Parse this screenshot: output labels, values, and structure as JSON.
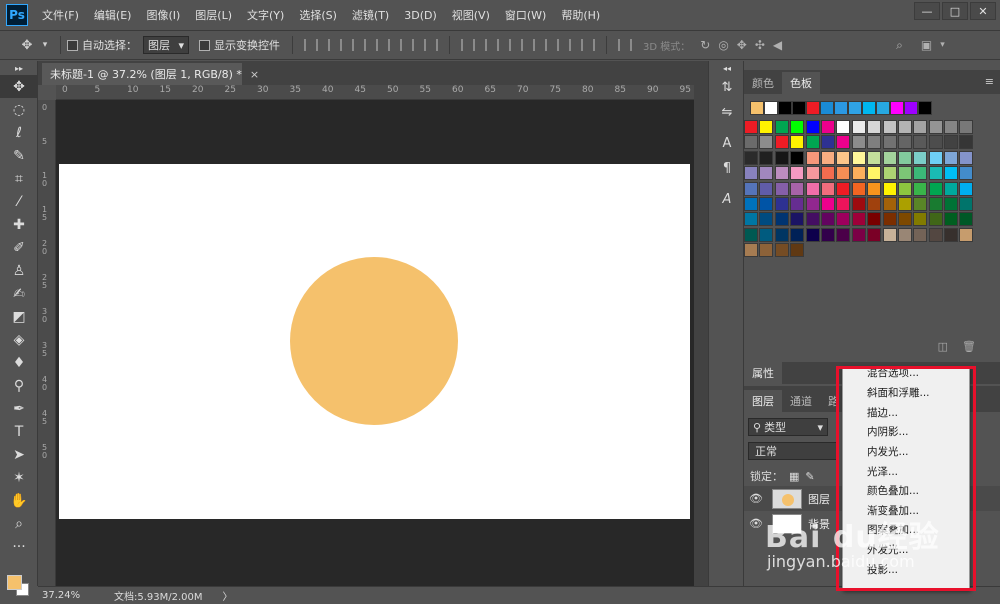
{
  "app": {
    "logo": "Ps"
  },
  "menu": [
    "文件(F)",
    "编辑(E)",
    "图像(I)",
    "图层(L)",
    "文字(Y)",
    "选择(S)",
    "滤镜(T)",
    "3D(D)",
    "视图(V)",
    "窗口(W)",
    "帮助(H)"
  ],
  "window_controls": {
    "minimize": "—",
    "restore": "□",
    "close": "✕"
  },
  "options": {
    "auto_select_label": "自动选择：",
    "auto_select_value": "图层",
    "show_transform_label": "显示变换控件",
    "mode_3d_label": "3D 模式："
  },
  "document": {
    "tab_title": "未标题-1 @ 37.2% (图层 1, RGB/8) *",
    "close": "×",
    "circle_color": "#f5c16c",
    "foreground_color": "#f5c16c"
  },
  "ruler": {
    "top": [
      "0",
      "5",
      "10",
      "15",
      "20",
      "25",
      "30",
      "35",
      "40",
      "45",
      "50",
      "55",
      "60",
      "65",
      "70",
      "75",
      "80",
      "85",
      "90",
      "95"
    ],
    "left": [
      "0",
      "5",
      "1\n0",
      "1\n5",
      "2\n0",
      "2\n5",
      "3\n0",
      "3\n5",
      "4\n0",
      "4\n5",
      "5\n0"
    ]
  },
  "status": {
    "zoom": "37.24%",
    "doc_info": "文档:5.93M/2.00M",
    "arrow": "〉"
  },
  "swatches_panel": {
    "tabs": [
      "颜色",
      "色板"
    ],
    "active_tab": 1,
    "recent": [
      "#f5c16c",
      "#ffffff",
      "#000000",
      "#000000",
      "#ee1c25",
      "#1a8bd6",
      "#2b98e2",
      "#2fa3e6",
      "#00b7ef",
      "#27a8e0",
      "#ff00ff",
      "#9e00ff",
      "#000000"
    ],
    "grid": [
      "#ee1c25",
      "#fff200",
      "#00a651",
      "#00ff00",
      "#0000ff",
      "#ec008c",
      "#ffffff",
      "#ebebeb",
      "#d7d7d7",
      "#c3c3c3",
      "#b3b3b3",
      "#a3a3a3",
      "#949494",
      "#858585",
      "#787878",
      "#6b6b6b",
      "#8c8c8c",
      "#ee1c25",
      "#fff200",
      "#00a651",
      "#2e3192",
      "#ec008c",
      "#8c8c8c",
      "#7f7f7f",
      "#727272",
      "#656565",
      "#595959",
      "#4d4d4d",
      "#424242",
      "#363636",
      "#2b2b2b",
      "#202020",
      "#161616",
      "#000000",
      "#f7977a",
      "#f9ad81",
      "#fdc68a",
      "#fff79a",
      "#c4df9b",
      "#a3d39c",
      "#82ca9d",
      "#7bcdc8",
      "#6ecff6",
      "#7ea7d8",
      "#8493ca",
      "#8882be",
      "#a187be",
      "#bc8dbf",
      "#f49ac2",
      "#f6989d",
      "#f26c4f",
      "#f68e55",
      "#fbaf5c",
      "#fff467",
      "#acd372",
      "#7cc576",
      "#3bb878",
      "#1abbb4",
      "#00bff3",
      "#438ccb",
      "#5574b9",
      "#605ca8",
      "#855fa8",
      "#a763a8",
      "#f06ea9",
      "#f26d7d",
      "#ed1c24",
      "#f26522",
      "#f7941d",
      "#fff200",
      "#8dc63f",
      "#39b54a",
      "#00a651",
      "#00a99d",
      "#00aeef",
      "#0072bc",
      "#0054a6",
      "#2e3192",
      "#662d91",
      "#92278f",
      "#ec008c",
      "#ed145b",
      "#9e0b0f",
      "#a0410d",
      "#a36209",
      "#aba000",
      "#598527",
      "#197b30",
      "#007236",
      "#00746b",
      "#0076a3",
      "#004b80",
      "#003471",
      "#1b1464",
      "#440e62",
      "#630460",
      "#9e005d",
      "#9e0039",
      "#790000",
      "#7b2e00",
      "#7d4900",
      "#827b00",
      "#406618",
      "#005e20",
      "#005826",
      "#005952",
      "#005b7f",
      "#003663",
      "#002157",
      "#0d004c",
      "#32004b",
      "#4b0049",
      "#7b0046",
      "#7a0026",
      "#c7b299",
      "#998675",
      "#736357",
      "#534741",
      "#37302d",
      "#c69c6d",
      "#a67c52",
      "#8c6239",
      "#754c24",
      "#603913"
    ]
  },
  "properties_panel": {
    "title": "属性"
  },
  "layers_panel": {
    "tabs": [
      "图层",
      "通道",
      "路"
    ],
    "filter_label": "类型",
    "blend_mode": "正常",
    "lock_label": "锁定：",
    "layers": [
      {
        "name": "图层",
        "eye": "👁"
      },
      {
        "name": "背景",
        "eye": "👁"
      }
    ]
  },
  "context_menu": {
    "items": [
      "混合选项...",
      "斜面和浮雕...",
      "描边...",
      "内阴影...",
      "内发光...",
      "光泽...",
      "颜色叠加...",
      "渐变叠加...",
      "图案叠加...",
      "外发光...",
      "投影..."
    ]
  },
  "watermark": {
    "logo": "Bai du经验",
    "url": "jingyan.baidu.com"
  },
  "colors": {
    "highlight": "#e8102b"
  }
}
